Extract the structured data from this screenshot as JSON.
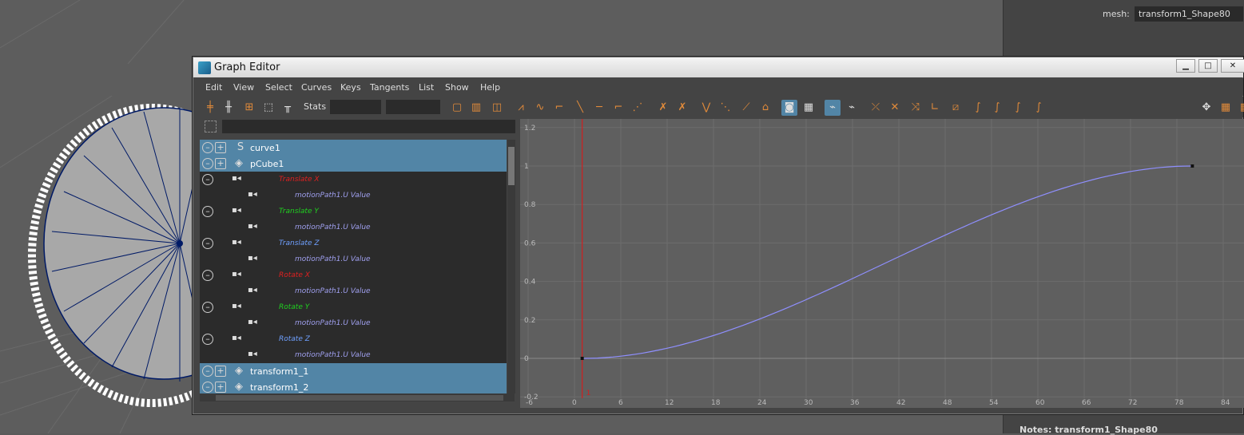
{
  "right_panel": {
    "mesh_label": "mesh:",
    "mesh_value": "transform1_Shape80",
    "notes": "Notes: transform1_Shape80"
  },
  "window": {
    "title": "Graph Editor",
    "minimize": "▁",
    "maximize": "□",
    "close": "✕"
  },
  "menu": [
    "Edit",
    "View",
    "Select",
    "Curves",
    "Keys",
    "Tangents",
    "List",
    "Show",
    "Help"
  ],
  "toolbar": {
    "stats_label": "Stats"
  },
  "outliner": {
    "rows": [
      {
        "type": "node",
        "name": "curve1",
        "icon": "curve-icon",
        "selected": true
      },
      {
        "type": "node",
        "name": "pCube1",
        "icon": "mesh-icon",
        "selected": true
      },
      {
        "type": "attr",
        "name": "Translate X",
        "color": "#e02020"
      },
      {
        "type": "sub",
        "name": "motionPath1.U Value"
      },
      {
        "type": "attr",
        "name": "Translate Y",
        "color": "#20d020"
      },
      {
        "type": "sub",
        "name": "motionPath1.U Value"
      },
      {
        "type": "attr",
        "name": "Translate Z",
        "color": "#6fa0ff"
      },
      {
        "type": "sub",
        "name": "motionPath1.U Value"
      },
      {
        "type": "attr",
        "name": "Rotate X",
        "color": "#e02020"
      },
      {
        "type": "sub",
        "name": "motionPath1.U Value"
      },
      {
        "type": "attr",
        "name": "Rotate Y",
        "color": "#20d020"
      },
      {
        "type": "sub",
        "name": "motionPath1.U Value"
      },
      {
        "type": "attr",
        "name": "Rotate Z",
        "color": "#6fa0ff"
      },
      {
        "type": "sub",
        "name": "motionPath1.U Value"
      },
      {
        "type": "node",
        "name": "transform1_1",
        "icon": "mesh-icon",
        "selected": true
      },
      {
        "type": "node",
        "name": "transform1_2",
        "icon": "mesh-icon",
        "selected": true
      }
    ]
  },
  "graph": {
    "x_ticks": [
      "-6",
      "0",
      "6",
      "12",
      "18",
      "24",
      "30",
      "36",
      "42",
      "48",
      "54",
      "60",
      "66",
      "72",
      "78",
      "84"
    ],
    "y_ticks": [
      "1.2",
      "1",
      "0.8",
      "0.6",
      "0.4",
      "0.2",
      "0",
      "-0.2"
    ],
    "current_frame": "1",
    "curve_color": "#8f8fff",
    "time_marker_color": "#d02020",
    "keys": [
      {
        "frame": 1,
        "value": 0
      },
      {
        "frame": 80,
        "value": 1
      }
    ]
  }
}
